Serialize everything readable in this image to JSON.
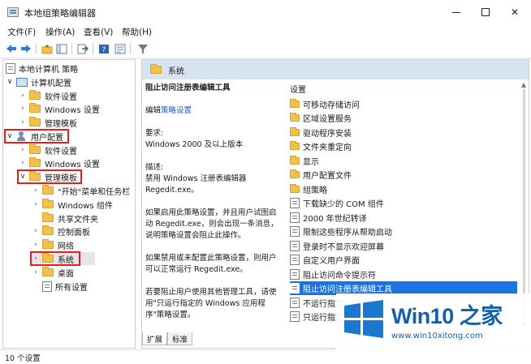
{
  "window": {
    "title": "本地组策略编辑器"
  },
  "menubar": [
    "文件(F)",
    "操作(A)",
    "查看(V)",
    "帮助(H)"
  ],
  "tree": {
    "root": "本地计算机 策略",
    "computer_config": "计算机配置",
    "computer_children": [
      "软件设置",
      "Windows 设置",
      "管理模板"
    ],
    "user_config": "用户配置",
    "user_children": [
      "软件设置",
      "Windows 设置",
      "管理模板"
    ],
    "admin_templates_children": [
      "\"开始\"菜单和任务栏",
      "Windows 组件",
      "共享文件夹",
      "控制面板",
      "网络",
      "系统",
      "桌面",
      "所有设置"
    ]
  },
  "right_header": "系统",
  "description": {
    "title": "阻止访问注册表编辑工具",
    "edit_prefix": "编辑",
    "edit_link": "策略设置",
    "req_label": "要求:",
    "req_value": "Windows 2000 及以上版本",
    "desc_label": "描述:",
    "desc_value": "禁用 Windows 注册表编辑器 Regedit.exe。",
    "para1": "如果启用此策略设置，并且用户试图启动 Regedit.exe，则会出现一条消息，说明策略设置会阻止此操作。",
    "para2": "如果禁用或未配置此策略设置，则用户可以正常运行 Regedit.exe。",
    "para3": "若要阻止用户使用其他管理工具，请使用\"只运行指定的 Windows 应用程序\"策略设置。"
  },
  "list": {
    "column": "设置",
    "folders": [
      "可移动存储访问",
      "区域设置服务",
      "驱动程序安装",
      "文件夹重定向",
      "显示",
      "用户配置文件",
      "组策略"
    ],
    "policies": [
      "下载缺少的 COM 组件",
      "2000 年世纪转译",
      "限制这些程序从帮助启动",
      "登录时不显示欢迎屏幕",
      "自定义用户界面",
      "阻止访问命令提示符",
      "阻止访问注册表编辑工具",
      "不运行指定",
      "只运行指定"
    ],
    "selected": "阻止访问注册表编辑工具"
  },
  "tabs": [
    "扩展",
    "标准"
  ],
  "status": "10 个设置",
  "watermark": {
    "title": "Win10 之家",
    "url": "www.win10xitong.com"
  }
}
